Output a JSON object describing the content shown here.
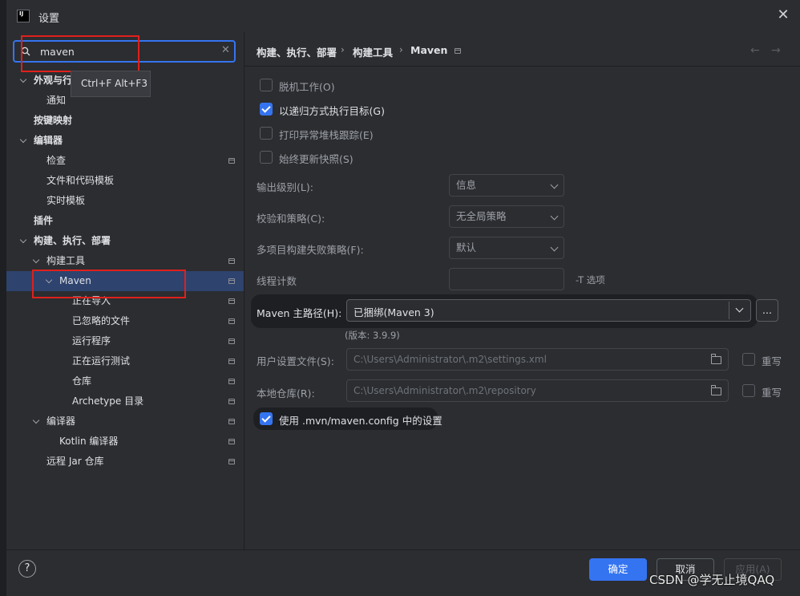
{
  "window": {
    "title": "设置",
    "app_icon_text": "IJ"
  },
  "search": {
    "value": "maven",
    "shortcut_tooltip": "Ctrl+F Alt+F3"
  },
  "tree": [
    {
      "label": "外观与行",
      "bold": true
    },
    {
      "label": "通知",
      "bold": false
    },
    {
      "label": "按键映射",
      "bold": true
    },
    {
      "label": "编辑器",
      "bold": true
    },
    {
      "label": "检查",
      "bold": false
    },
    {
      "label": "文件和代码模板",
      "bold": false
    },
    {
      "label": "实时模板",
      "bold": false
    },
    {
      "label": "插件",
      "bold": true
    },
    {
      "label": "构建、执行、部署",
      "bold": true
    },
    {
      "label": "构建工具",
      "bold": false
    },
    {
      "label": "Maven",
      "bold": false
    },
    {
      "label": "正在导入",
      "bold": false
    },
    {
      "label": "已忽略的文件",
      "bold": false
    },
    {
      "label": "运行程序",
      "bold": false
    },
    {
      "label": "正在运行测试",
      "bold": false
    },
    {
      "label": "仓库",
      "bold": false
    },
    {
      "label": "Archetype 目录",
      "bold": false
    },
    {
      "label": "编译器",
      "bold": false
    },
    {
      "label": "Kotlin 编译器",
      "bold": false
    },
    {
      "label": "远程 Jar 仓库",
      "bold": false
    }
  ],
  "breadcrumb": {
    "part1": "构建、执行、部署",
    "part2": "构建工具",
    "part3": "Maven",
    "sep": "›"
  },
  "nav": {
    "back": "←",
    "forward": "→"
  },
  "options": {
    "offline": {
      "label": "脱机工作(O)",
      "checked": false
    },
    "recursive": {
      "label": "以递归方式执行目标(G)",
      "checked": true
    },
    "print_stack": {
      "label": "打印异常堆栈跟踪(E)",
      "checked": false
    },
    "always_update": {
      "label": "始终更新快照(S)",
      "checked": false
    }
  },
  "fields": {
    "output_level": {
      "label": "输出级别(L):",
      "value": "信息"
    },
    "checksum": {
      "label": "校验和策略(C):",
      "value": "无全局策略"
    },
    "multiproject": {
      "label": "多项目构建失败策略(F):",
      "value": "默认"
    },
    "threads": {
      "label": "线程计数",
      "value": "",
      "suffix": "-T 选项"
    },
    "maven_home": {
      "label": "Maven 主路径(H):",
      "value": "已捆绑(Maven 3)",
      "browse": "...",
      "version": "(版本: 3.9.9)"
    },
    "user_settings": {
      "label": "用户设置文件(S):",
      "value": "C:\\Users\\Administrator\\.m2\\settings.xml",
      "override": "重写"
    },
    "local_repo": {
      "label": "本地仓库(R):",
      "value": "C:\\Users\\Administrator\\.m2\\repository",
      "override": "重写"
    },
    "use_mvn_config": {
      "label": "使用 .mvn/maven.config 中的设置",
      "checked": true
    }
  },
  "footer": {
    "help": "?",
    "ok": "确定",
    "cancel": "取消",
    "apply": "应用(A)"
  },
  "watermark": "CSDN @学无止境QAQ",
  "colors": {
    "accent": "#3574f0",
    "highlight": "#e0201c",
    "selection": "#2e436e"
  }
}
